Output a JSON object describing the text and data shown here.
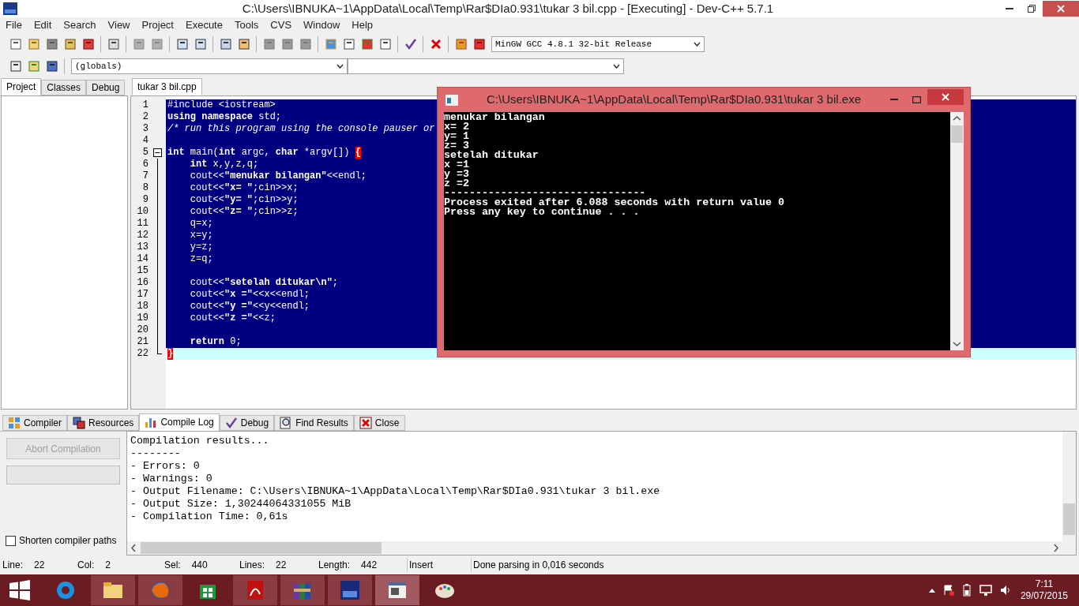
{
  "window": {
    "title": "C:\\Users\\IBNUKA~1\\AppData\\Local\\Temp\\Rar$DIa0.931\\tukar 3 bil.cpp - [Executing] - Dev-C++ 5.7.1"
  },
  "menu": [
    "File",
    "Edit",
    "Search",
    "View",
    "Project",
    "Execute",
    "Tools",
    "CVS",
    "Window",
    "Help"
  ],
  "compiler_select": {
    "value": "MinGW GCC 4.8.1 32-bit Release"
  },
  "scope_select": {
    "value": "(globals)"
  },
  "left_tabs": [
    {
      "label": "Project",
      "selected": true
    },
    {
      "label": "Classes",
      "selected": false
    },
    {
      "label": "Debug",
      "selected": false
    }
  ],
  "editor_tab": {
    "label": "tukar 3 bil.cpp",
    "selected": true
  },
  "code": [
    {
      "number": "1",
      "kind": "plain",
      "text": "#include <iostream>",
      "selected": true,
      "current": false
    },
    {
      "number": "2",
      "kind": "plain",
      "text": "**using** **namespace** std;",
      "selected": true,
      "current": false
    },
    {
      "number": "3",
      "kind": "comment",
      "text": "/* run this program using the console pauser or",
      "selected": true,
      "current": false
    },
    {
      "number": "4",
      "kind": "plain",
      "selected": true,
      "current": false
    },
    {
      "number": "5",
      "kind": "foldstart",
      "text": "**int** main(**int** argc, **char** *argv[]) ",
      "brace": "{",
      "selected": true,
      "current": false
    },
    {
      "number": "6",
      "kind": "foldbody",
      "text": "    **int** x,y,z,q;",
      "selected": true,
      "current": false
    },
    {
      "number": "7",
      "kind": "foldbody",
      "text": "    cout<<**\"menukar bilangan\"**<<endl;",
      "selected": true,
      "current": false
    },
    {
      "number": "8",
      "kind": "foldbody",
      "text": "    cout<<**\"x= \"**;cin>>x;",
      "selected": true,
      "current": false
    },
    {
      "number": "9",
      "kind": "foldbody",
      "text": "    cout<<**\"y= \"**;cin>>y;",
      "selected": true,
      "current": false
    },
    {
      "number": "10",
      "kind": "foldbody",
      "text": "    cout<<**\"z= \"**;cin>>z;",
      "selected": true,
      "current": false
    },
    {
      "number": "11",
      "kind": "foldbody",
      "text": "    q=x;",
      "selected": true,
      "current": false
    },
    {
      "number": "12",
      "kind": "foldbody",
      "text": "    x=y;",
      "selected": true,
      "current": false
    },
    {
      "number": "13",
      "kind": "foldbody",
      "text": "    y=z;",
      "selected": true,
      "current": false
    },
    {
      "number": "14",
      "kind": "foldbody",
      "text": "    z=q;",
      "selected": true,
      "current": false
    },
    {
      "number": "15",
      "kind": "foldbody",
      "selected": true,
      "current": false
    },
    {
      "number": "16",
      "kind": "foldbody",
      "text": "    cout<<**\"setelah ditukar\\n\"**;",
      "selected": true,
      "current": false
    },
    {
      "number": "17",
      "kind": "foldbody",
      "text": "    cout<<**\"x =\"**<<x<<endl;",
      "selected": true,
      "current": false
    },
    {
      "number": "18",
      "kind": "foldbody",
      "text": "    cout<<**\"y =\"**<<y<<endl;",
      "selected": true,
      "current": false
    },
    {
      "number": "19",
      "kind": "foldbody",
      "text": "    cout<<**\"z =\"**<<z;",
      "selected": true,
      "current": false
    },
    {
      "number": "20",
      "kind": "foldbody",
      "selected": true,
      "current": false
    },
    {
      "number": "21",
      "kind": "foldbody",
      "text": "    **return** 0;",
      "selected": true,
      "current": false
    },
    {
      "number": "22",
      "kind": "foldend",
      "brace": "}",
      "selected": false,
      "current": true
    }
  ],
  "console": {
    "title": "C:\\Users\\IBNUKA~1\\AppData\\Local\\Temp\\Rar$DIa0.931\\tukar 3 bil.exe",
    "lines": [
      "menukar bilangan",
      "x= 2",
      "y= 1",
      "z= 3",
      "setelah ditukar",
      "x =1",
      "y =3",
      "z =2",
      "--------------------------------",
      "Process exited after 6.088 seconds with return value 0",
      "Press any key to continue . . ."
    ]
  },
  "bottom_tabs": [
    {
      "label": "Compiler",
      "selected": false
    },
    {
      "label": "Resources",
      "selected": false
    },
    {
      "label": "Compile Log",
      "selected": true
    },
    {
      "label": "Debug",
      "selected": false
    },
    {
      "label": "Find Results",
      "selected": false
    },
    {
      "label": "Close",
      "selected": false
    }
  ],
  "abort_button": {
    "label": "Abort Compilation",
    "disabled": true
  },
  "progress": {
    "level": 0
  },
  "shorten_paths": {
    "label": "Shorten compiler paths",
    "checked": false
  },
  "compile_log": [
    "Compilation results...",
    "--------",
    "- Errors: 0",
    "- Warnings: 0",
    "- Output Filename: C:\\Users\\IBNUKA~1\\AppData\\Local\\Temp\\Rar$DIa0.931\\tukar 3 bil.exe",
    "- Output Size: 1,30244064331055 MiB",
    "- Compilation Time: 0,61s"
  ],
  "status_bar": {
    "fields": [
      {
        "label": "Line:",
        "value": "22"
      },
      {
        "label": "Col:",
        "value": "2"
      },
      {
        "label": "Sel:",
        "value": "440"
      },
      {
        "label": "Lines:",
        "value": "22"
      },
      {
        "label": "Length:",
        "value": "442"
      }
    ],
    "mode": "Insert",
    "message": "Done parsing in 0,016 seconds"
  },
  "taskbar": {
    "time": "7:11",
    "date": "29/07/2015"
  }
}
